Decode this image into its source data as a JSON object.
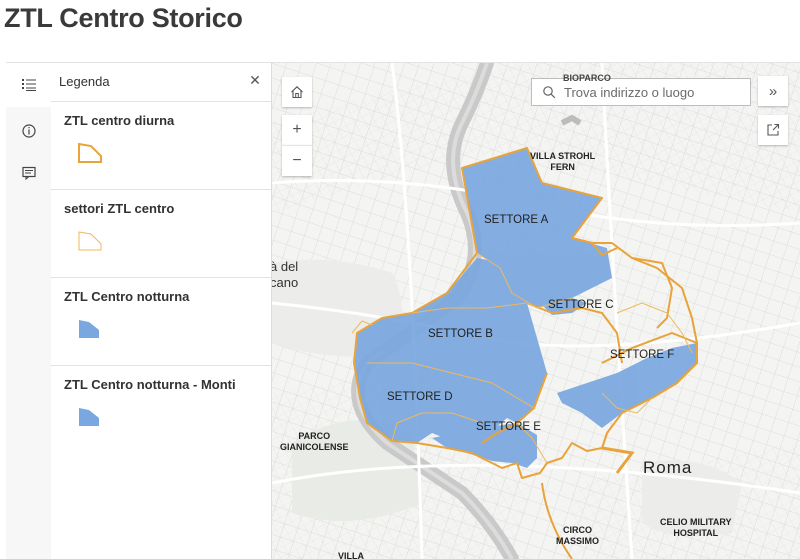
{
  "page": {
    "title": "ZTL Centro Storico"
  },
  "action_bar": {
    "items": [
      {
        "name": "legend",
        "icon": "legend-list-icon",
        "active": true
      },
      {
        "name": "about",
        "icon": "info-icon",
        "active": false
      },
      {
        "name": "details",
        "icon": "details-icon",
        "active": false
      }
    ]
  },
  "legend": {
    "title": "Legenda",
    "close_icon": "close-icon",
    "layers": [
      {
        "label": "ZTL centro diurna",
        "swatch": "outline-thick",
        "color": "#e8a33a"
      },
      {
        "label": "settori ZTL centro",
        "swatch": "outline-thin",
        "color": "#f0b85a"
      },
      {
        "label": "ZTL Centro notturna",
        "swatch": "fill",
        "color": "#7aa7e0"
      },
      {
        "label": "ZTL Centro notturna - Monti",
        "swatch": "fill",
        "color": "#7aa7e0"
      }
    ]
  },
  "map": {
    "search_placeholder": "Trova indirizzo o luogo",
    "controls": {
      "home_icon": "home-icon",
      "zoom_in_label": "+",
      "zoom_out_label": "−",
      "expand_label": "»",
      "share_icon": "share-icon"
    },
    "colors": {
      "zone_fill": "#7aa7e0",
      "zone_outline": "#e8a33a",
      "river": "#c9c9c9"
    },
    "sectors": [
      "SETTORE A",
      "SETTORE B",
      "SETTORE C",
      "SETTORE D",
      "SETTORE E",
      "SETTORE F"
    ],
    "labels": {
      "villa": [
        "VILLA STROHL",
        "FERN"
      ],
      "parco": [
        "PARCO",
        "GIANICOLENSE"
      ],
      "circo": [
        "CIRCO",
        "MASSIMO"
      ],
      "celio": [
        "CELIO MILITARY",
        "HOSPITAL"
      ],
      "city": "Roma",
      "vaticano": [
        "à del",
        "cano"
      ],
      "top_partial": "BIOPARCO",
      "bottom_partial": "VILLA"
    }
  }
}
